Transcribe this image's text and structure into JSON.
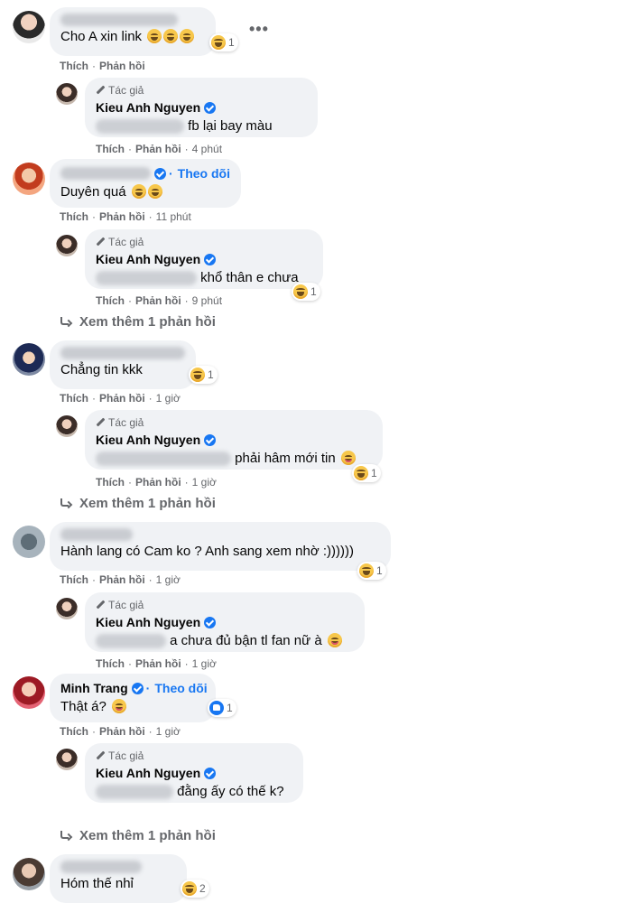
{
  "ui": {
    "like": "Thích",
    "reply": "Phản hồi",
    "author_badge": "Tác giả",
    "follow": "Theo dõi",
    "page_author": "Kieu Anh Nguyen",
    "more_icon": "more-dots-icon"
  },
  "comments": [
    {
      "text": "Cho A xin link",
      "reaction_count": "1",
      "reply": {
        "text": "fb lại bay màu",
        "time": "4 phút"
      }
    },
    {
      "text": "Duyên quá",
      "time": "11 phút",
      "reply": {
        "text": "khổ thân e chưa",
        "time": "9 phút",
        "reaction_count": "1"
      },
      "see_more": "Xem thêm 1 phản hồi"
    },
    {
      "text": "Chẳng tin kkk",
      "time": "1 giờ",
      "reaction_count": "1",
      "reply": {
        "text": "phải hâm mới tin",
        "time": "1 giờ",
        "reaction_count": "1"
      },
      "see_more": "Xem thêm 1 phản hồi"
    },
    {
      "text": "Hành lang có Cam ko ? Anh sang xem nhờ :))))))",
      "time": "1 giờ",
      "reaction_count": "1",
      "reply": {
        "text": "a chưa đủ bận tl fan nữ à",
        "time": "1 giờ"
      }
    },
    {
      "author": "Minh Trang",
      "text": "Thật á?",
      "time": "1 giờ",
      "reaction_count": "1",
      "reply": {
        "text": "đằng ấy có thế k?"
      },
      "see_more": "Xem thêm 1 phản hồi"
    },
    {
      "text": "Hóm thế nhỉ",
      "reaction_count": "2"
    }
  ]
}
